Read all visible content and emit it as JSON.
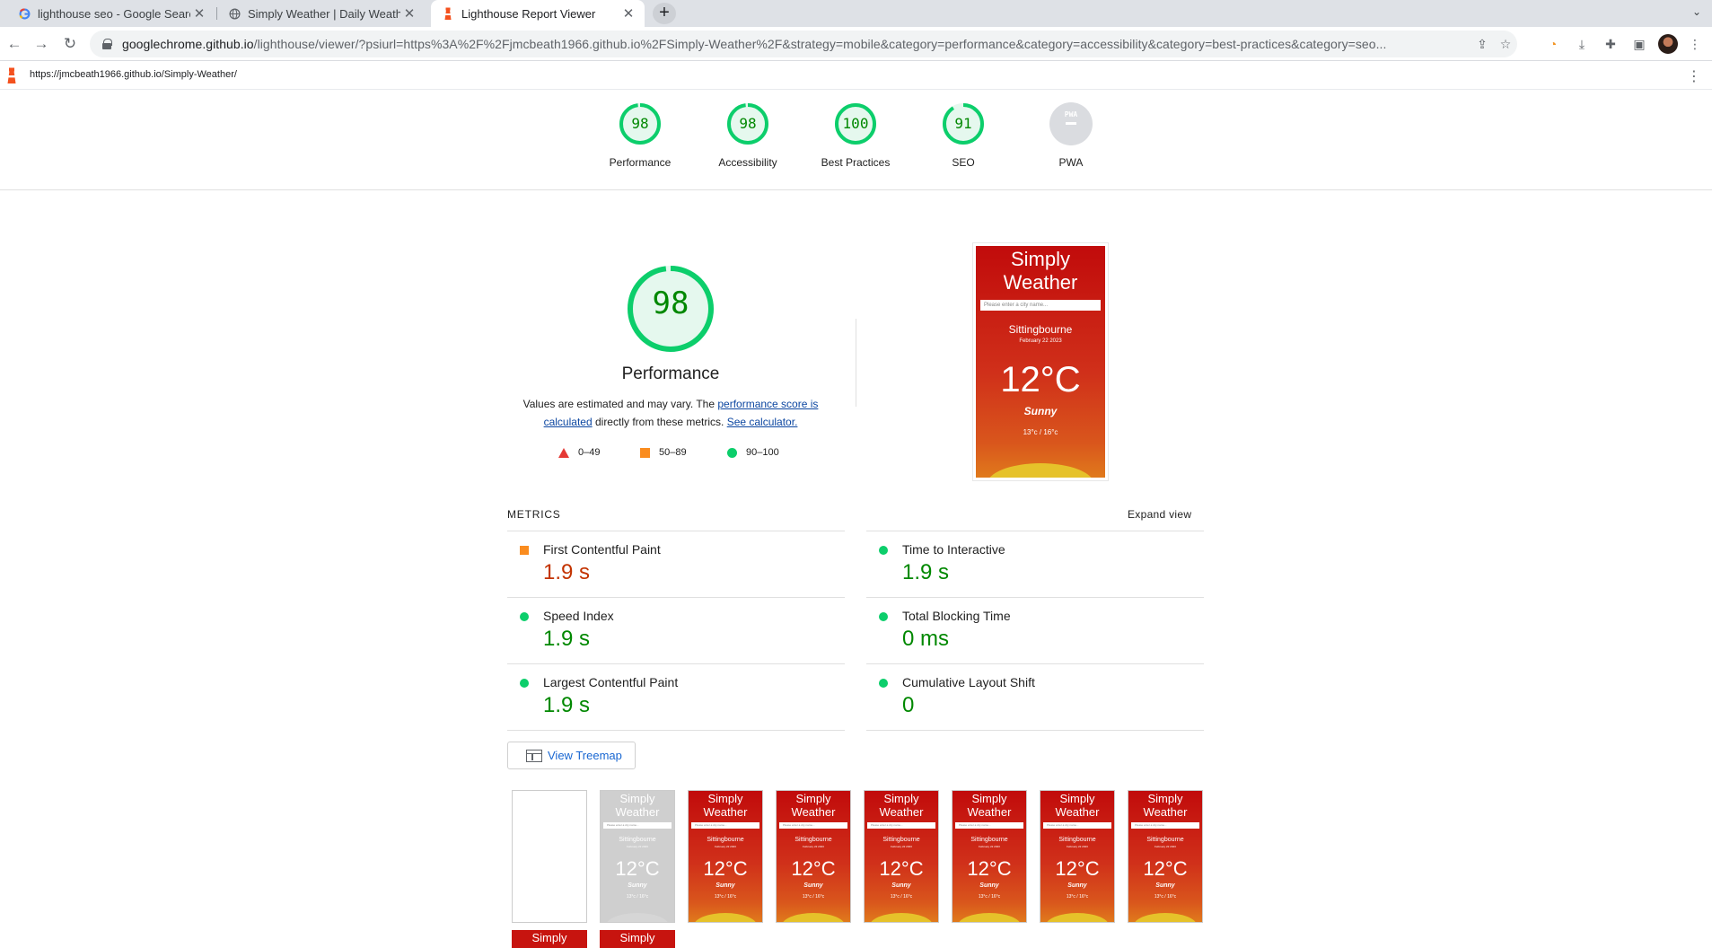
{
  "browser": {
    "tabs": [
      {
        "title": "lighthouse seo - Google Search",
        "icon": "google-icon",
        "active": false
      },
      {
        "title": "Simply Weather | Daily Weather",
        "icon": "globe-icon",
        "active": false
      },
      {
        "title": "Lighthouse Report Viewer",
        "icon": "lighthouse-icon",
        "active": true
      }
    ],
    "url_host": "googlechrome.github.io",
    "url_path": "/lighthouse/viewer/?psiurl=https%3A%2F%2Fjmcbeath1966.github.io%2FSimply-Weather%2F&strategy=mobile&category=performance&category=accessibility&category=best-practices&category=seo..."
  },
  "report": {
    "tested_url": "https://jmcbeath1966.github.io/Simply-Weather/"
  },
  "categories": [
    {
      "label": "Performance",
      "score": "98",
      "value": 98
    },
    {
      "label": "Accessibility",
      "score": "98",
      "value": 98
    },
    {
      "label": "Best Practices",
      "score": "100",
      "value": 100
    },
    {
      "label": "SEO",
      "score": "91",
      "value": 91
    },
    {
      "label": "PWA",
      "score": "PWA",
      "value": null
    }
  ],
  "performance": {
    "score": "98",
    "value": 98,
    "title": "Performance",
    "desc_prefix": "Values are estimated and may vary. The ",
    "desc_link1": "performance score is calculated",
    "desc_middle": " directly from these metrics. ",
    "desc_link2": "See calculator.",
    "legend": [
      {
        "range": "0–49",
        "shape": "triangle",
        "color": "#e53935"
      },
      {
        "range": "50–89",
        "shape": "square",
        "color": "#fa8c1f"
      },
      {
        "range": "90–100",
        "shape": "circle",
        "color": "#0cce6b"
      }
    ]
  },
  "screenshot": {
    "title": "Simply Weather",
    "search_placeholder": "Please enter a city name...",
    "city": "Sittingbourne",
    "date": "February 22 2023",
    "temp": "12°C",
    "condition": "Sunny",
    "range": "13°c / 16°c"
  },
  "metrics": {
    "label": "METRICS",
    "expand_label": "Expand view",
    "items": [
      {
        "name": "First Contentful Paint",
        "value": "1.9 s",
        "rating": "avg"
      },
      {
        "name": "Time to Interactive",
        "value": "1.9 s",
        "rating": "pass"
      },
      {
        "name": "Speed Index",
        "value": "1.9 s",
        "rating": "pass"
      },
      {
        "name": "Total Blocking Time",
        "value": "0 ms",
        "rating": "pass"
      },
      {
        "name": "Largest Contentful Paint",
        "value": "1.9 s",
        "rating": "pass"
      },
      {
        "name": "Cumulative Layout Shift",
        "value": "0",
        "rating": "pass"
      }
    ]
  },
  "treemap": {
    "label": "View Treemap"
  },
  "filmstrip": {
    "frames": [
      "blank",
      "grey",
      "red",
      "red",
      "red",
      "red",
      "red",
      "red"
    ],
    "row2_label": "Simply"
  },
  "colors": {
    "pass": "#0cce6b",
    "pass_text": "#008800",
    "average": "#fa8c1f",
    "average_text": "#c33300",
    "fail": "#e53935",
    "link": "#0d47a1"
  }
}
